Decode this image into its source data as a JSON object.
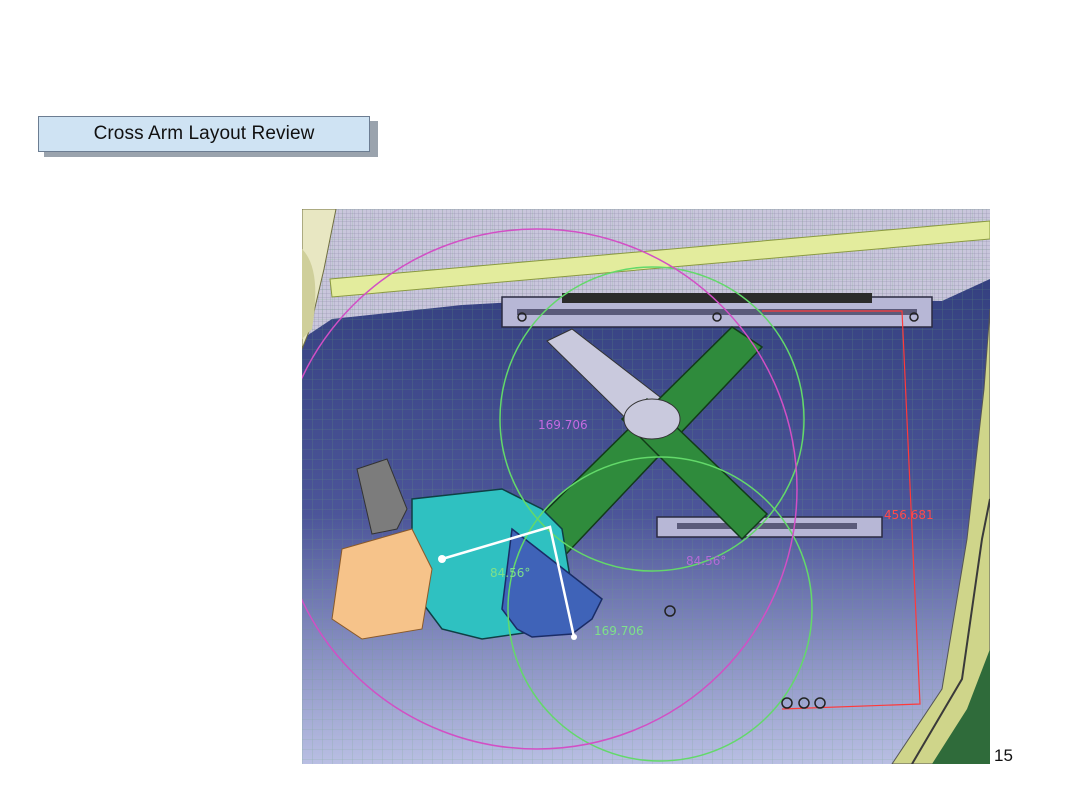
{
  "slide": {
    "title": "Cross Arm Layout  Review",
    "page_number": "15"
  },
  "diagram": {
    "dimensions": {
      "upper_arm_length": "169.706",
      "lower_arm_length": "169.706",
      "rail_span": "456.681",
      "left_angle": "84.56°",
      "right_angle": "84.56°"
    },
    "colors": {
      "background_top": "#2d3a78",
      "background_bottom": "#b9bfe3",
      "grid": "#5f9a6a",
      "arm": "#2f8b3c",
      "bracket": "#2fc1c1",
      "motor": "#f6c38a",
      "sector_gear": "#3f63b8",
      "rail": "#b7b7d6",
      "glass_edge": "#e3ec9d",
      "circle_green": "#63d96a",
      "circle_magenta": "#d24fc5",
      "dimension_red": "#ff3a3a"
    }
  }
}
